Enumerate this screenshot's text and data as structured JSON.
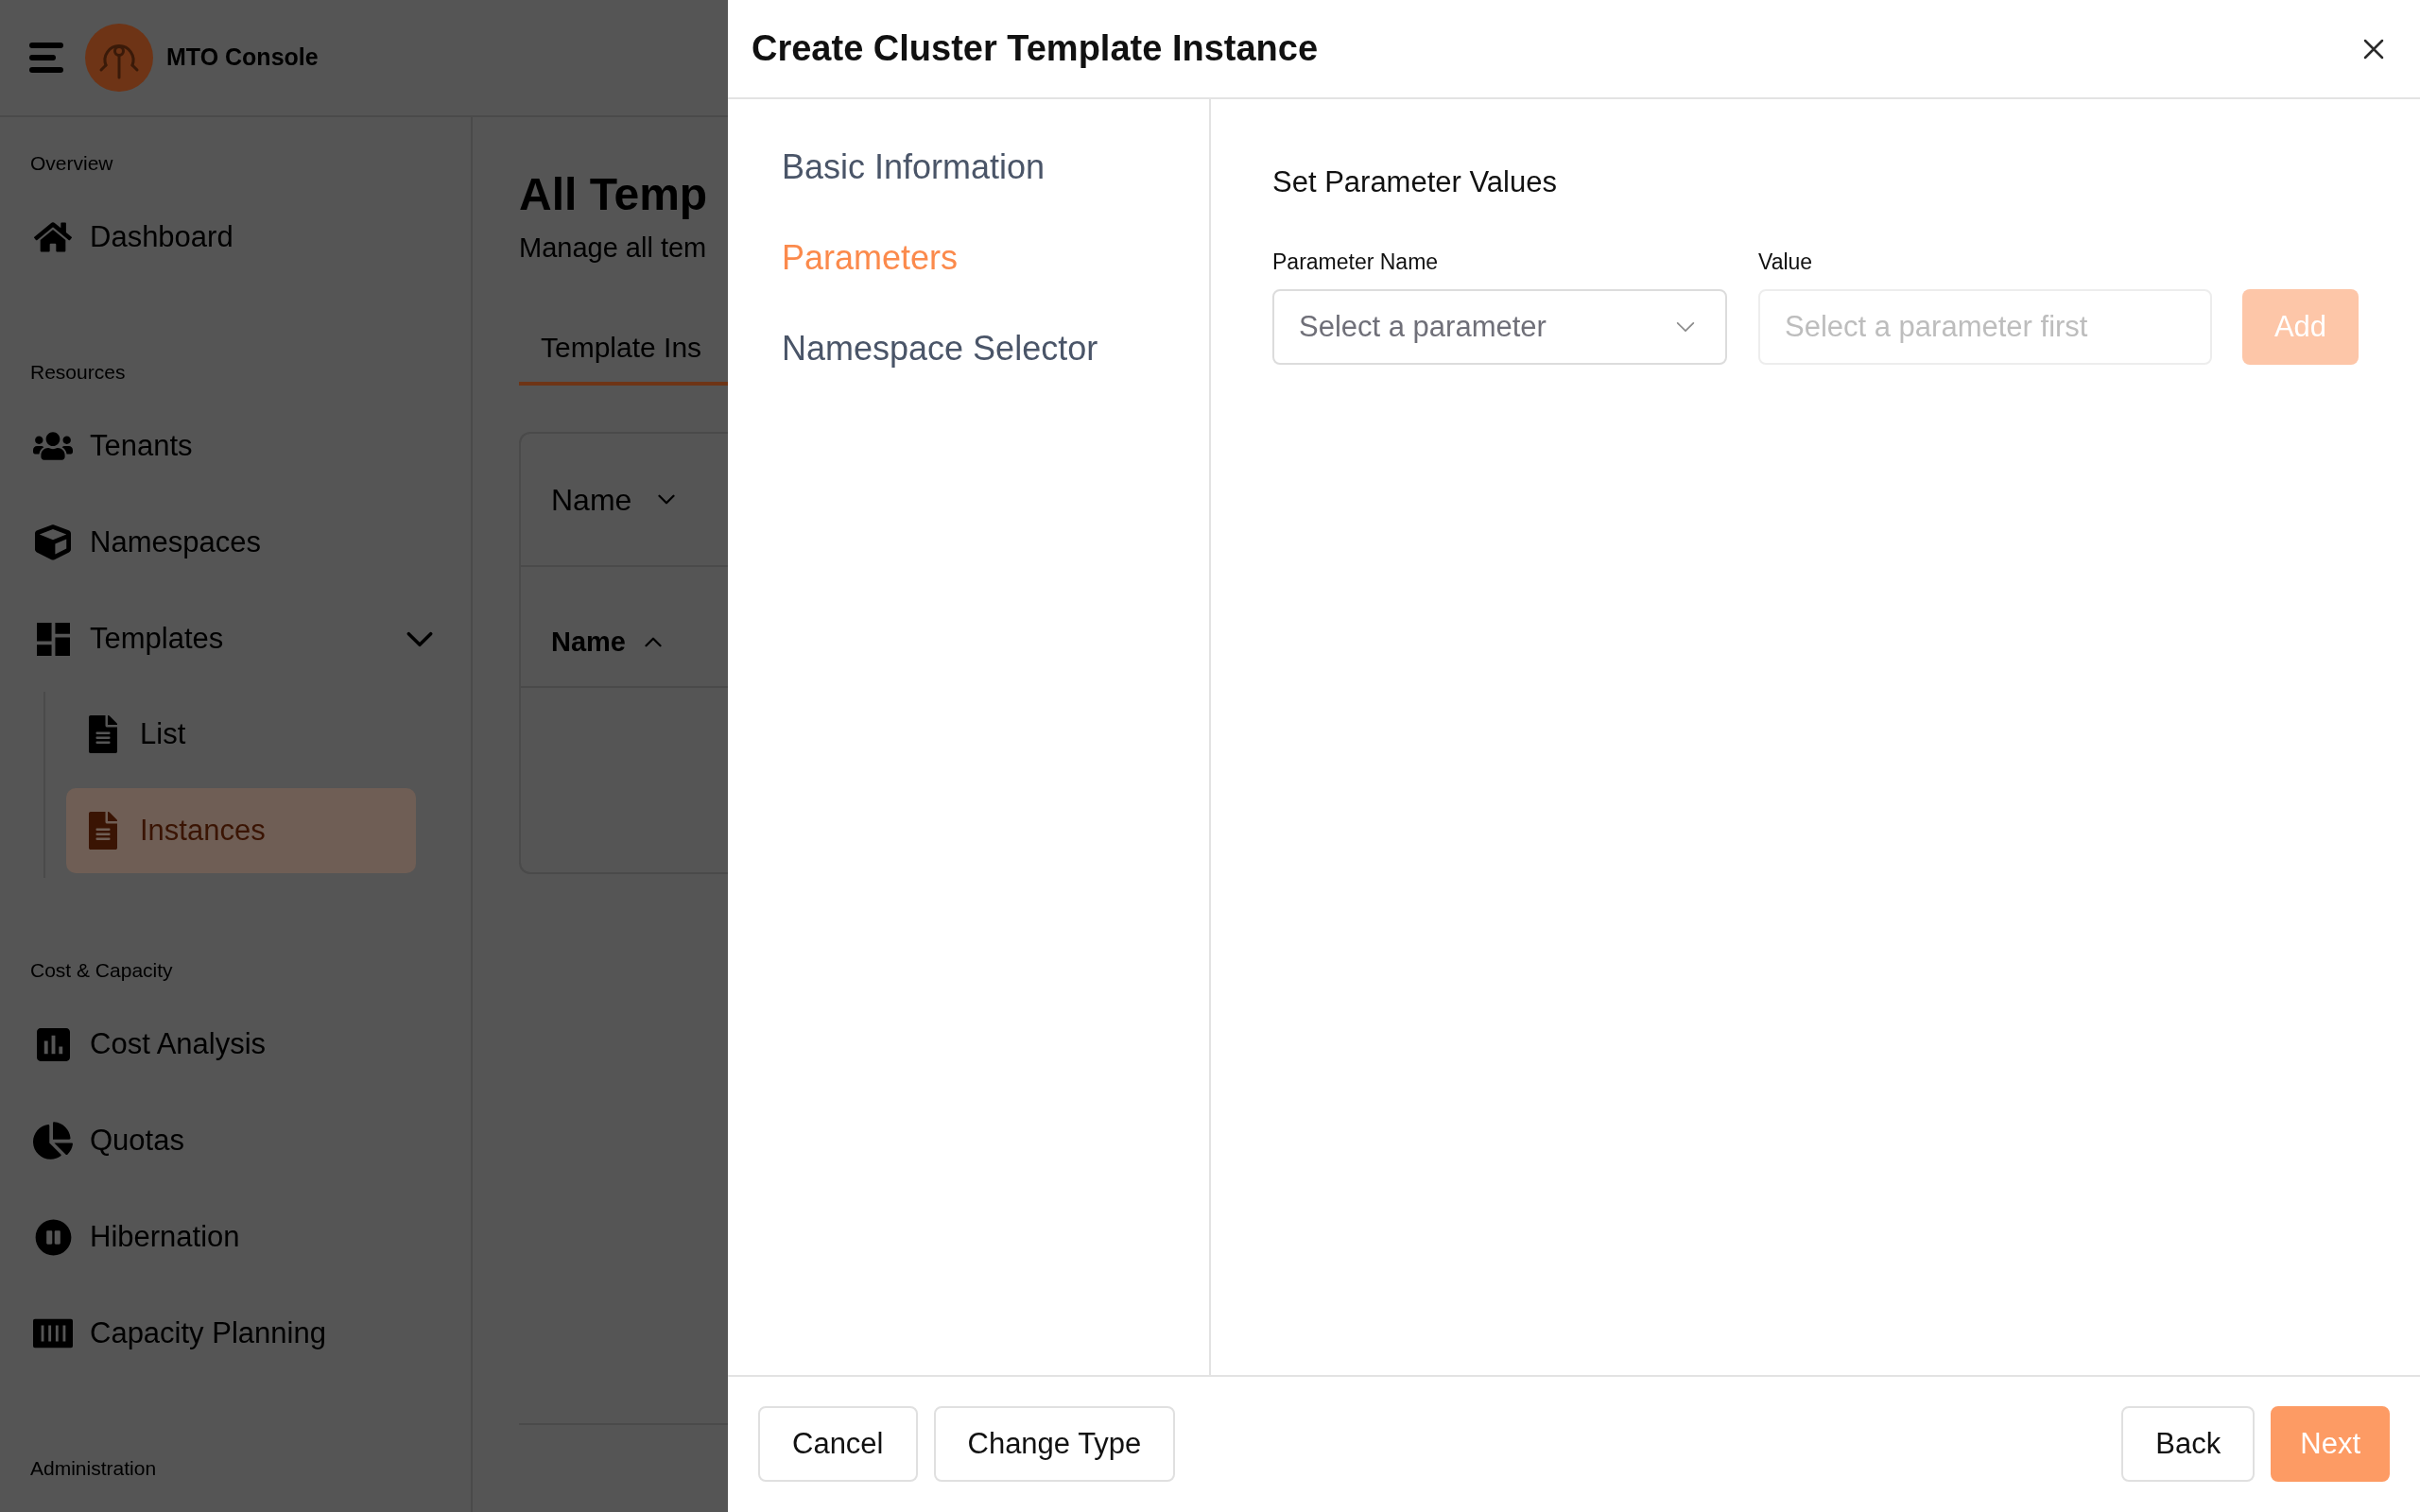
{
  "app_header": {
    "title": "MTO Console"
  },
  "sidebar": {
    "sections": [
      {
        "label": "Overview",
        "items": [
          {
            "label": "Dashboard",
            "selected": false
          }
        ]
      },
      {
        "label": "Resources",
        "items": [
          {
            "label": "Tenants",
            "selected": false
          },
          {
            "label": "Namespaces",
            "selected": false
          },
          {
            "label": "Templates",
            "selected": false,
            "expanded": true,
            "children": [
              {
                "label": "List",
                "selected": false
              },
              {
                "label": "Instances",
                "selected": true
              }
            ]
          }
        ]
      },
      {
        "label": "Cost & Capacity",
        "items": [
          {
            "label": "Cost Analysis",
            "selected": false
          },
          {
            "label": "Quotas",
            "selected": false
          },
          {
            "label": "Hibernation",
            "selected": false
          },
          {
            "label": "Capacity Planning",
            "selected": false
          }
        ]
      },
      {
        "label": "Administration"
      }
    ]
  },
  "page": {
    "title": "All Temp",
    "subtitle": "Manage all tem",
    "tabs": [
      {
        "label": "Template Ins",
        "selected": true
      }
    ],
    "table": {
      "filter": {
        "label": "Name"
      },
      "columns": [
        {
          "label": "Name",
          "sorted_ascending": true
        }
      ]
    }
  },
  "dialog": {
    "title": "Create Cluster Template Instance",
    "steps": [
      {
        "label": "Basic Information",
        "selected": false
      },
      {
        "label": "Parameters",
        "selected": true
      },
      {
        "label": "Namespace Selector",
        "selected": false
      }
    ],
    "section_title": "Set Parameter Values",
    "parameter_field": {
      "label": "Parameter Name",
      "placeholder": "Select a parameter"
    },
    "value_field": {
      "label": "Value",
      "placeholder": "Select a parameter first",
      "disabled": true
    },
    "add_button": {
      "label": "Add",
      "disabled": true
    },
    "footer": {
      "left_buttons": [
        {
          "label": "Cancel"
        },
        {
          "label": "Change Type"
        }
      ],
      "right_buttons": [
        {
          "label": "Back",
          "kind": "secondary"
        },
        {
          "label": "Next",
          "kind": "primary"
        }
      ]
    }
  }
}
